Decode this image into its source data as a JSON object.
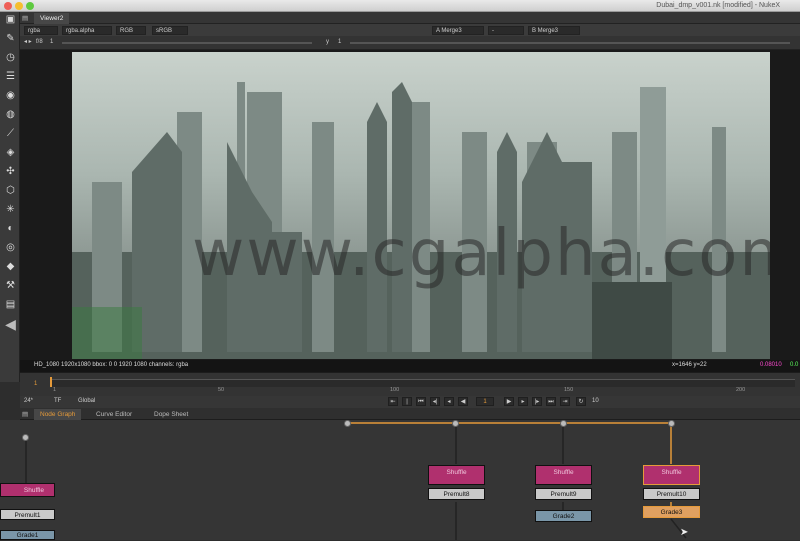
{
  "window": {
    "title": "Dubai_dmp_v001.nk [modified] - NukeX"
  },
  "viewer": {
    "tab": "Viewer2",
    "channels": "rgba",
    "alpha_channel": "rgba.alpha",
    "display": "RGB",
    "lut": "sRGB",
    "input_a": "A  Merge3",
    "input_sep": "-",
    "input_b": "B  Merge3",
    "fstop_label": "f/8",
    "fstop_value": "1",
    "y_label": "y",
    "y_value": "1"
  },
  "image": {
    "watermark": "www.cgalpha.com"
  },
  "infobar": {
    "left": "HD_1080 1920x1080  bbox: 0 0 1920 1080 channels: rgba",
    "coords": "x=1646 y=22",
    "value_red": "0.08010",
    "value_green": "0.0"
  },
  "timeline": {
    "current_frame": "1",
    "ticks": [
      "1",
      "50",
      "100",
      "150",
      "200"
    ],
    "fps": "24*",
    "tf": "TF",
    "scope": "Global",
    "frame_field": "1",
    "step": "10"
  },
  "tabs": {
    "node_graph": "Node Graph",
    "curve_editor": "Curve Editor",
    "dope_sheet": "Dope Sheet"
  },
  "nodes": {
    "shuffle_left": "Shuffle",
    "premult_left": "Premult1",
    "node_left_bottom": "Grade1",
    "shuffle1": "Shuffle",
    "premult8": "Premult8",
    "shuffle2": "Shuffle",
    "premult9": "Premult9",
    "grade2": "Grade2",
    "shuffle3": "Shuffle",
    "premult10": "Premult10",
    "grade3": "Grade3"
  },
  "toolbar_icons": [
    "image-icon",
    "draw-icon",
    "time-icon",
    "channel-icon",
    "color-icon",
    "filter-icon",
    "keyer-icon",
    "merge-icon",
    "transform-icon",
    "3d-icon",
    "particles-icon",
    "deep-icon",
    "views-icon",
    "metadata-icon",
    "toolsets-icon",
    "other-icon",
    "furnace-icon",
    "back-icon"
  ],
  "colors": {
    "accent_orange": "#e59a3a",
    "node_shuffle": "#b0306e",
    "node_grade": "#7a96a8",
    "value_red": "#ff4ad2",
    "value_green": "#5cff5c"
  }
}
